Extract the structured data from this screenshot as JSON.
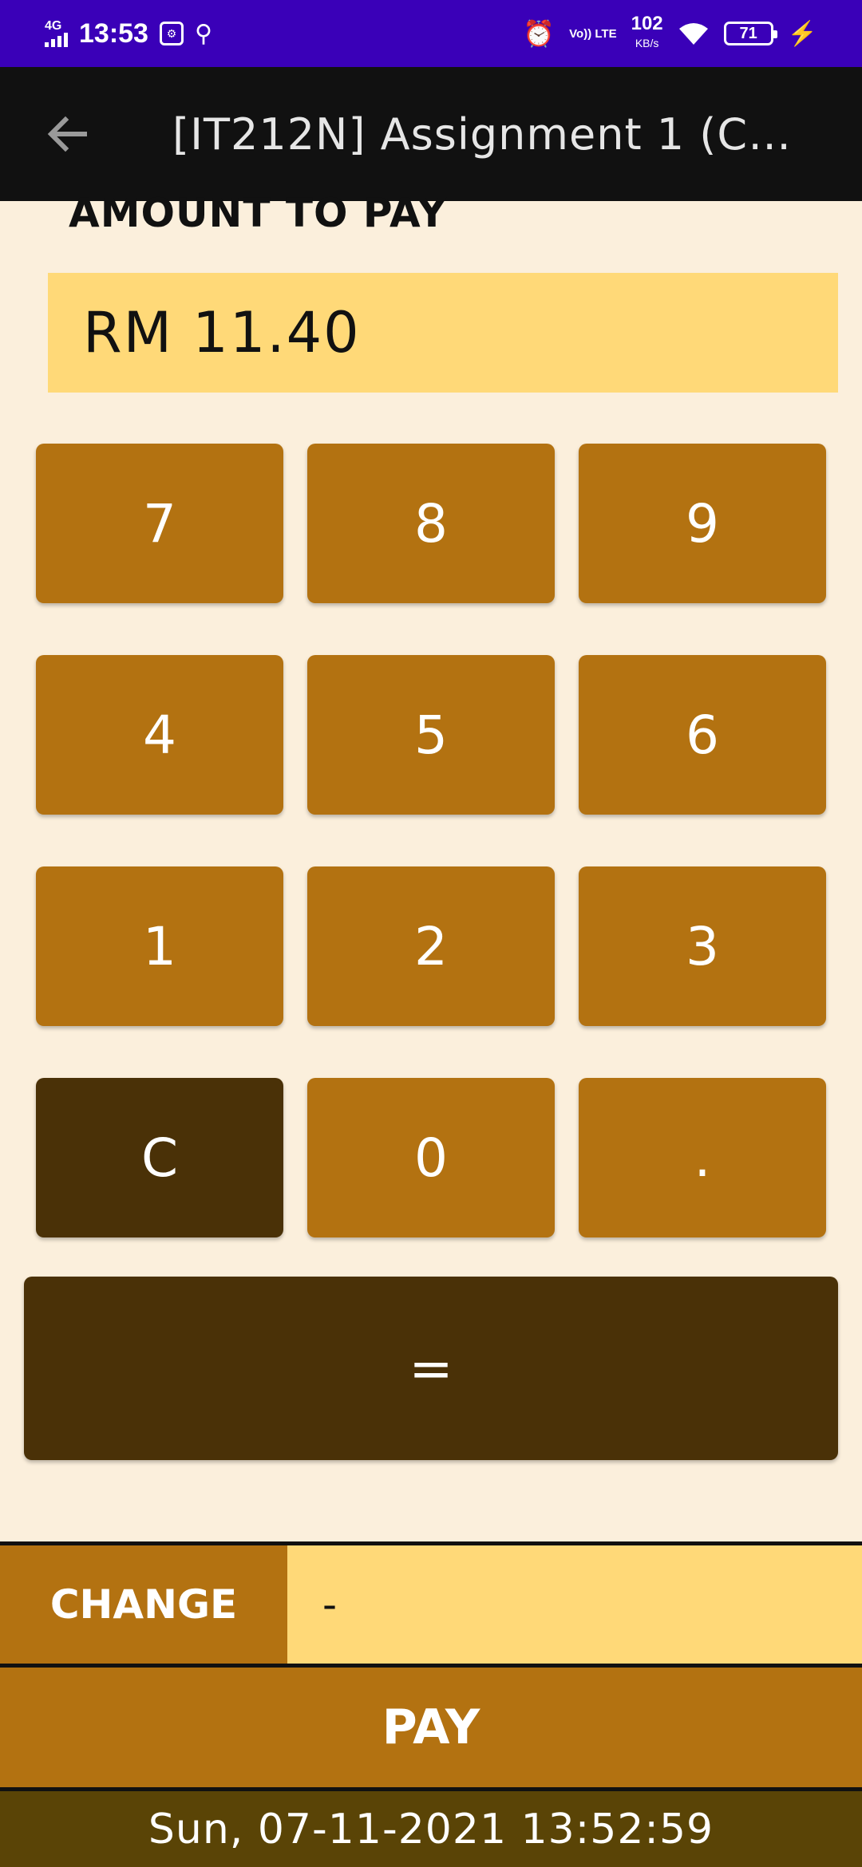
{
  "status_bar": {
    "network": "4G",
    "time": "13:53",
    "speed_value": "102",
    "speed_unit": "KB/s",
    "volte": "Vo)) LTE",
    "battery": "71"
  },
  "app_bar": {
    "title": "[IT212N] Assignment 1 (Ch..."
  },
  "amount": {
    "label": "AMOUNT TO PAY",
    "value": "RM 11.40"
  },
  "keypad": {
    "keys": [
      "7",
      "8",
      "9",
      "4",
      "5",
      "6",
      "1",
      "2",
      "3",
      "C",
      "0",
      "."
    ],
    "equals": "="
  },
  "change": {
    "label": "CHANGE",
    "value": "-"
  },
  "pay_button": "PAY",
  "datetime": "Sun, 07-11-2021  13:52:59",
  "colors": {
    "status_bar": "#3a00b8",
    "app_bar": "#111111",
    "background": "#fbefdc",
    "amount_box": "#ffd978",
    "key": "#b37211",
    "key_dark": "#4a3107",
    "datetime_bar": "#5a4406"
  }
}
